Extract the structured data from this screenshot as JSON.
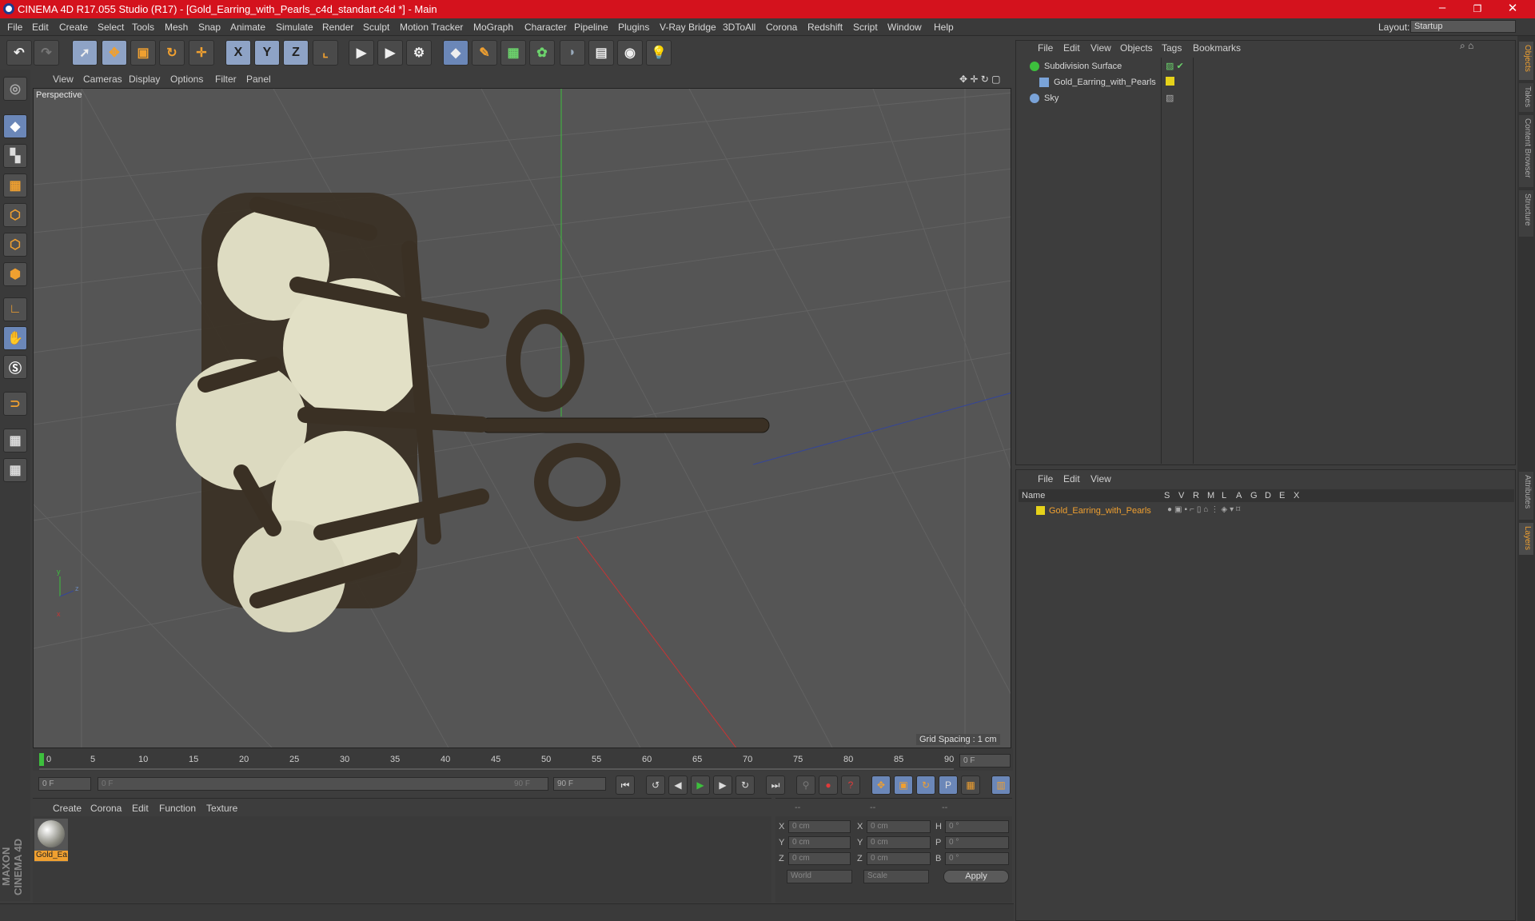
{
  "window": {
    "title": "CINEMA 4D R17.055 Studio (R17) - [Gold_Earring_with_Pearls_c4d_standart.c4d *] - Main",
    "minimize": "–",
    "restore": "❐",
    "close": "✕"
  },
  "menubar": {
    "items": [
      "File",
      "Edit",
      "Create",
      "Select",
      "Tools",
      "Mesh",
      "Snap",
      "Animate",
      "Simulate",
      "Render",
      "Sculpt",
      "Motion Tracker",
      "MoGraph",
      "Character",
      "Pipeline",
      "Plugins",
      "V-Ray Bridge",
      "3DToAll",
      "Corona",
      "Redshift",
      "Script",
      "Window",
      "Help"
    ],
    "layout_label": "Layout:",
    "layout_value": "Startup"
  },
  "toolbar": {
    "axis": [
      "X",
      "Y",
      "Z"
    ]
  },
  "viewport": {
    "menu": [
      "View",
      "Cameras",
      "Display",
      "Options",
      "Filter",
      "Panel"
    ],
    "label": "Perspective",
    "grid_spacing": "Grid Spacing : 1 cm"
  },
  "timeline": {
    "ticks": [
      "0",
      "5",
      "10",
      "15",
      "20",
      "25",
      "30",
      "35",
      "40",
      "45",
      "50",
      "55",
      "60",
      "65",
      "70",
      "75",
      "80",
      "85",
      "90"
    ],
    "end_field": "0 F",
    "start": "0 F",
    "range_start": "0 F",
    "range_end": "90 F",
    "max": "90 F"
  },
  "material": {
    "menu": [
      "Create",
      "Corona",
      "Edit",
      "Function",
      "Texture"
    ],
    "item_label": "Gold_Ea"
  },
  "coords": {
    "header": [
      "--",
      "--",
      "--"
    ],
    "rows": [
      {
        "a": "X",
        "av": "0 cm",
        "b": "X",
        "bv": "0 cm",
        "c": "H",
        "cv": "0 °"
      },
      {
        "a": "Y",
        "av": "0 cm",
        "b": "Y",
        "bv": "0 cm",
        "c": "P",
        "cv": "0 °"
      },
      {
        "a": "Z",
        "av": "0 cm",
        "b": "Z",
        "bv": "0 cm",
        "c": "B",
        "cv": "0 °"
      }
    ],
    "world": "World",
    "scale": "Scale",
    "apply": "Apply"
  },
  "objects": {
    "menu": [
      "File",
      "Edit",
      "View",
      "Objects",
      "Tags",
      "Bookmarks"
    ],
    "items": [
      "Subdivision Surface",
      "Gold_Earring_with_Pearls",
      "Sky"
    ]
  },
  "layers": {
    "menu": [
      "File",
      "Edit",
      "View"
    ],
    "columns": [
      "Name",
      "S",
      "V",
      "R",
      "M",
      "L",
      "A",
      "G",
      "D",
      "E",
      "X"
    ],
    "item": "Gold_Earring_with_Pearls"
  },
  "right_tabs": [
    "Objects",
    "Takes",
    "Content Browser",
    "Structure",
    "Attributes",
    "Layers"
  ],
  "brand": "MAXON CINEMA 4D",
  "colors": {
    "title": "#d4121d",
    "accent": "#f0a030",
    "layer_name": "#f0a030",
    "material_dot": "#e6d21a"
  }
}
